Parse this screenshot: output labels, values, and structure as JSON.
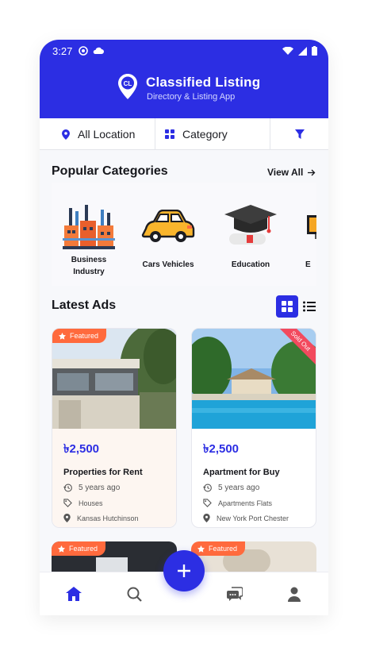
{
  "status_bar": {
    "time": "3:27"
  },
  "header": {
    "title": "Classified Listing",
    "subtitle": "Directory & Listing App",
    "logo_text": "CL"
  },
  "filters": {
    "location": "All Location",
    "category": "Category"
  },
  "popular": {
    "title": "Popular Categories",
    "view_all": "View All",
    "items": [
      {
        "label_line1": "Business",
        "label_line2": "Industry",
        "icon": "factory-icon"
      },
      {
        "label_line1": "Cars  Vehicles",
        "label_line2": "",
        "icon": "car-icon"
      },
      {
        "label_line1": "Education",
        "label_line2": "",
        "icon": "graduation-cap-icon"
      },
      {
        "label_line1": "E",
        "label_line2": "",
        "icon": "tv-icon"
      }
    ]
  },
  "latest": {
    "title": "Latest Ads",
    "ads": [
      {
        "badge": "Featured",
        "price": "৳2,500",
        "title": "Properties for Rent",
        "time": "5 years ago",
        "tags": "Houses",
        "location": "Kansas Hutchinson"
      },
      {
        "ribbon": "Sold Out",
        "price": "৳2,500",
        "title": "Apartment for Buy",
        "time": "5 years ago",
        "tags": "Apartments  Flats",
        "location": "New York Port Chester"
      }
    ],
    "more_badges": [
      "Featured",
      "Featured"
    ]
  },
  "colors": {
    "primary": "#2c2ee3",
    "accent": "#ff6a3d",
    "ribbon": "#f24a5e"
  }
}
